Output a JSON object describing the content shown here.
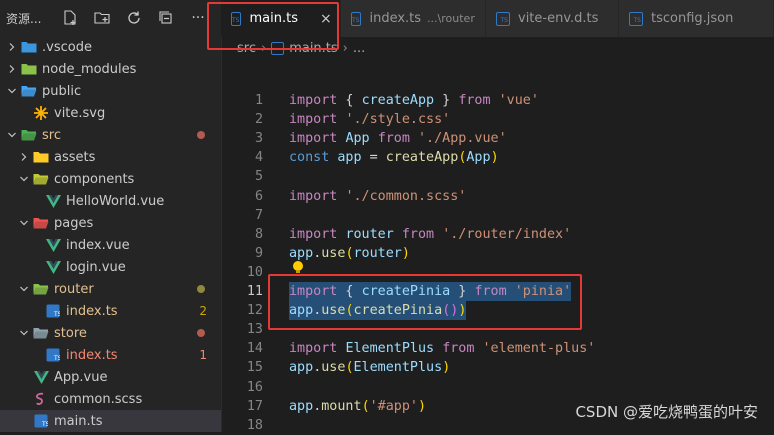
{
  "sidebar": {
    "title": "资源...",
    "tree": [
      {
        "label": ".vscode",
        "depth": 0,
        "type": "folder",
        "open": false,
        "color": "#cccccc",
        "icon": "vscode-folder-icon",
        "icon_color": "#3a96dd"
      },
      {
        "label": "node_modules",
        "depth": 0,
        "type": "folder",
        "open": false,
        "color": "#cccccc",
        "icon": "node-folder-icon",
        "icon_color": "#8bc34a"
      },
      {
        "label": "public",
        "depth": 0,
        "type": "folder",
        "open": true,
        "color": "#cccccc",
        "icon": "public-folder-icon",
        "icon_color": "#42a5f5"
      },
      {
        "label": "vite.svg",
        "depth": 1,
        "type": "file",
        "color": "#cccccc",
        "icon": "svg-icon",
        "icon_color": "#ffb300"
      },
      {
        "label": "src",
        "depth": 0,
        "type": "folder",
        "open": true,
        "color": "#e2c08d",
        "icon": "src-folder-icon",
        "icon_color": "#4caf50",
        "dot": "#b35b4f"
      },
      {
        "label": "assets",
        "depth": 1,
        "type": "folder",
        "open": false,
        "color": "#cccccc",
        "icon": "assets-folder-icon",
        "icon_color": "#ffca28"
      },
      {
        "label": "components",
        "depth": 1,
        "type": "folder",
        "open": true,
        "color": "#cccccc",
        "icon": "components-folder-icon",
        "icon_color": "#c0ca33"
      },
      {
        "label": "HelloWorld.vue",
        "depth": 2,
        "type": "file",
        "color": "#cccccc",
        "icon": "vue-icon",
        "icon_color": "#41b883"
      },
      {
        "label": "pages",
        "depth": 1,
        "type": "folder",
        "open": true,
        "color": "#cccccc",
        "icon": "pages-folder-icon",
        "icon_color": "#ef5350"
      },
      {
        "label": "index.vue",
        "depth": 2,
        "type": "file",
        "color": "#cccccc",
        "icon": "vue-icon",
        "icon_color": "#41b883"
      },
      {
        "label": "login.vue",
        "depth": 2,
        "type": "file",
        "color": "#cccccc",
        "icon": "vue-icon",
        "icon_color": "#41b883"
      },
      {
        "label": "router",
        "depth": 1,
        "type": "folder",
        "open": true,
        "color": "#e2c08d",
        "icon": "router-folder-icon",
        "icon_color": "#8bc34a",
        "dot": "#8f8a3e"
      },
      {
        "label": "index.ts",
        "depth": 2,
        "type": "file",
        "color": "#e2c08d",
        "icon": "ts-icon",
        "icon_color": "#3178c6",
        "badge": "2",
        "badge_color": "#cca700"
      },
      {
        "label": "store",
        "depth": 1,
        "type": "folder",
        "open": true,
        "color": "#e2c08d",
        "icon": "store-folder-icon",
        "icon_color": "#90a4ae",
        "dot": "#b35b4f"
      },
      {
        "label": "index.ts",
        "depth": 2,
        "type": "file",
        "color": "#f48771",
        "icon": "ts-icon",
        "icon_color": "#3178c6",
        "badge": "1",
        "badge_color": "#f48771"
      },
      {
        "label": "App.vue",
        "depth": 1,
        "type": "file",
        "color": "#cccccc",
        "icon": "vue-icon",
        "icon_color": "#41b883"
      },
      {
        "label": "common.scss",
        "depth": 1,
        "type": "file",
        "color": "#cccccc",
        "icon": "sass-icon",
        "icon_color": "#cd6799"
      },
      {
        "label": "main.ts",
        "depth": 1,
        "type": "file",
        "color": "#cccccc",
        "icon": "ts-icon",
        "icon_color": "#3178c6",
        "active": true
      }
    ]
  },
  "tabs": [
    {
      "label": "main.ts",
      "active": true,
      "close": "×"
    },
    {
      "label": "index.ts",
      "description": "...\\router"
    },
    {
      "label": "vite-env.d.ts"
    },
    {
      "label": "tsconfig.json"
    }
  ],
  "breadcrumb": {
    "folder": "src",
    "file": "main.ts",
    "tail": "..."
  },
  "editor": {
    "current_line": 11,
    "lines": [
      {
        "n": 1,
        "tokens": [
          [
            "import",
            "kw2"
          ],
          [
            " { ",
            "txt"
          ],
          [
            "createApp",
            "var"
          ],
          [
            " } ",
            "txt"
          ],
          [
            "from",
            "kw2"
          ],
          [
            " ",
            "txt"
          ],
          [
            "'vue'",
            "str"
          ]
        ]
      },
      {
        "n": 2,
        "tokens": [
          [
            "import",
            "kw2"
          ],
          [
            " ",
            "txt"
          ],
          [
            "'./style.css'",
            "str"
          ]
        ]
      },
      {
        "n": 3,
        "tokens": [
          [
            "import",
            "kw2"
          ],
          [
            " ",
            "txt"
          ],
          [
            "App",
            "var"
          ],
          [
            " ",
            "txt"
          ],
          [
            "from",
            "kw2"
          ],
          [
            " ",
            "txt"
          ],
          [
            "'./App.vue'",
            "str"
          ]
        ]
      },
      {
        "n": 4,
        "tokens": [
          [
            "const",
            "kw"
          ],
          [
            " ",
            "txt"
          ],
          [
            "app",
            "var"
          ],
          [
            " = ",
            "txt"
          ],
          [
            "createApp",
            "fn"
          ],
          [
            "(",
            "br2"
          ],
          [
            "App",
            "var"
          ],
          [
            ")",
            "br2"
          ]
        ]
      },
      {
        "n": 5,
        "tokens": []
      },
      {
        "n": 6,
        "tokens": [
          [
            "import",
            "kw2"
          ],
          [
            " ",
            "txt"
          ],
          [
            "'./common.scss'",
            "str"
          ]
        ]
      },
      {
        "n": 7,
        "tokens": []
      },
      {
        "n": 8,
        "tokens": [
          [
            "import",
            "kw2"
          ],
          [
            " ",
            "txt"
          ],
          [
            "router",
            "var"
          ],
          [
            " ",
            "txt"
          ],
          [
            "from",
            "kw2"
          ],
          [
            " ",
            "txt"
          ],
          [
            "'./router/index'",
            "str"
          ]
        ]
      },
      {
        "n": 9,
        "tokens": [
          [
            "app",
            "var"
          ],
          [
            ".",
            "txt"
          ],
          [
            "use",
            "fn"
          ],
          [
            "(",
            "br2"
          ],
          [
            "router",
            "var"
          ],
          [
            ")",
            "br2"
          ]
        ]
      },
      {
        "n": 10,
        "tokens": []
      },
      {
        "n": 11,
        "selected": true,
        "tokens": [
          [
            "import",
            "kw2"
          ],
          [
            " { ",
            "txt"
          ],
          [
            "createPinia",
            "var"
          ],
          [
            " } ",
            "txt"
          ],
          [
            "from",
            "kw2"
          ],
          [
            " ",
            "txt"
          ],
          [
            "'pinia'",
            "str"
          ]
        ]
      },
      {
        "n": 12,
        "selected": true,
        "tokens": [
          [
            "app",
            "var"
          ],
          [
            ".",
            "txt"
          ],
          [
            "use",
            "fn"
          ],
          [
            "(",
            "br2"
          ],
          [
            "createPinia",
            "fn"
          ],
          [
            "()",
            "br"
          ],
          [
            ")",
            "br2"
          ]
        ]
      },
      {
        "n": 13,
        "tokens": []
      },
      {
        "n": 14,
        "tokens": [
          [
            "import",
            "kw2"
          ],
          [
            " ",
            "txt"
          ],
          [
            "ElementPlus",
            "var"
          ],
          [
            " ",
            "txt"
          ],
          [
            "from",
            "kw2"
          ],
          [
            " ",
            "txt"
          ],
          [
            "'element-plus'",
            "str"
          ]
        ]
      },
      {
        "n": 15,
        "tokens": [
          [
            "app",
            "var"
          ],
          [
            ".",
            "txt"
          ],
          [
            "use",
            "fn"
          ],
          [
            "(",
            "br2"
          ],
          [
            "ElementPlus",
            "var"
          ],
          [
            ")",
            "br2"
          ]
        ]
      },
      {
        "n": 16,
        "tokens": []
      },
      {
        "n": 17,
        "tokens": [
          [
            "app",
            "var"
          ],
          [
            ".",
            "txt"
          ],
          [
            "mount",
            "fn"
          ],
          [
            "(",
            "br2"
          ],
          [
            "'#app'",
            "str"
          ],
          [
            ")",
            "br2"
          ]
        ]
      },
      {
        "n": 18,
        "tokens": []
      }
    ]
  },
  "watermark": "CSDN @爱吃烧鸭蛋的叶安",
  "colors": {
    "annotation_red": "#e53935",
    "selection": "#264f78",
    "background": "#1e1e1e"
  }
}
